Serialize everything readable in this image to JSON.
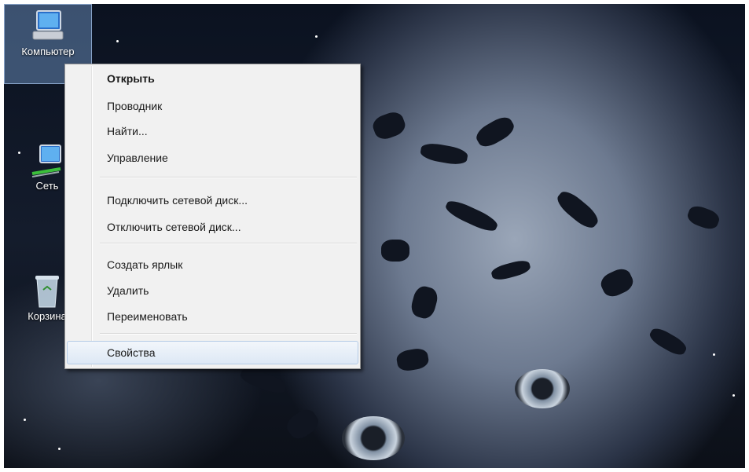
{
  "desktop": {
    "icons": [
      {
        "label": "Компьютер",
        "icon": "computer-icon"
      },
      {
        "label": "Сеть",
        "icon": "network-icon"
      },
      {
        "label": "Корзина",
        "icon": "recycle-bin-icon"
      }
    ]
  },
  "context_menu": {
    "items": [
      {
        "label": "Открыть"
      },
      {
        "label": "Проводник"
      },
      {
        "label": "Найти..."
      },
      {
        "label": "Управление"
      },
      {
        "label": "Подключить сетевой диск..."
      },
      {
        "label": "Отключить сетевой диск..."
      },
      {
        "label": "Создать ярлык"
      },
      {
        "label": "Удалить"
      },
      {
        "label": "Переименовать"
      },
      {
        "label": "Свойства"
      }
    ],
    "default_item": "Открыть",
    "highlighted_item": "Свойства"
  },
  "colors": {
    "menu_background": "#f1f1f1",
    "highlight": "#dde8f5",
    "selection": "#78a0d2"
  }
}
